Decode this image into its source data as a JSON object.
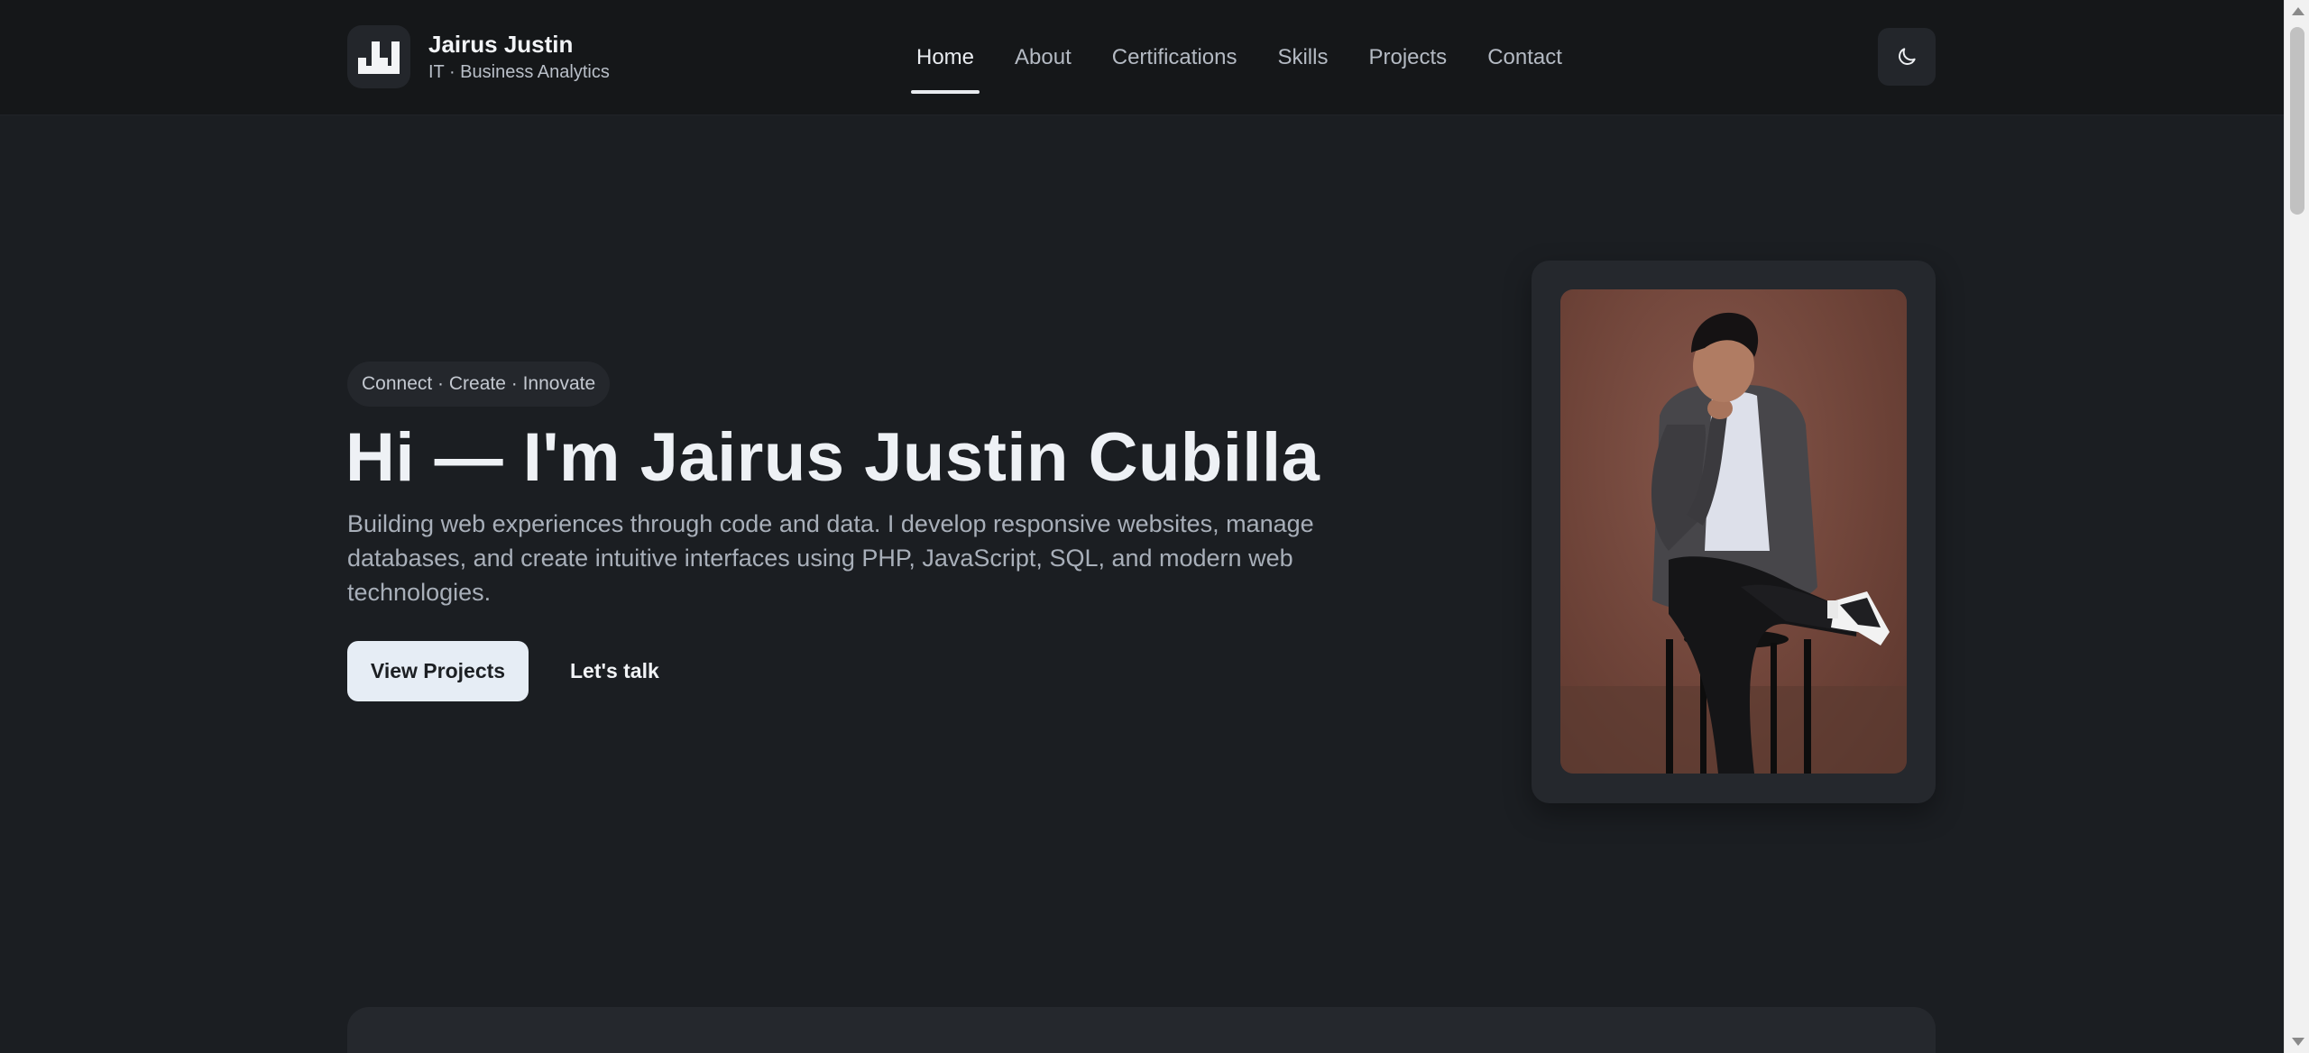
{
  "header": {
    "brand_name": "Jairus Justin",
    "brand_subtitle": "IT · Business Analytics",
    "logo_icon": "jj-monogram-icon",
    "nav": [
      {
        "label": "Home",
        "active": true
      },
      {
        "label": "About",
        "active": false
      },
      {
        "label": "Certifications",
        "active": false
      },
      {
        "label": "Skills",
        "active": false
      },
      {
        "label": "Projects",
        "active": false
      },
      {
        "label": "Contact",
        "active": false
      }
    ],
    "theme_toggle_icon": "moon-icon"
  },
  "hero": {
    "tagline": "Connect · Create · Innovate",
    "title": "Hi — I'm Jairus Justin Cubilla",
    "description": "Building web experiences through code and data. I develop responsive websites, manage databases, and create intuitive interfaces using PHP, JavaScript, SQL, and modern web technologies.",
    "primary_button": "View Projects",
    "secondary_button": "Let's talk",
    "photo_icon": "profile-photo"
  },
  "colors": {
    "background": "#1b1e22",
    "header_bg": "#151719",
    "card_bg": "#25282d",
    "primary_button_bg": "#e6edf5",
    "photo_backdrop": "#6f4439"
  }
}
